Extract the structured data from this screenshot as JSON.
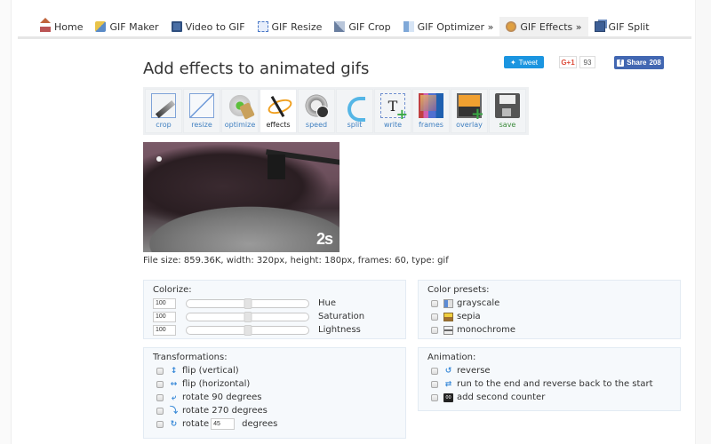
{
  "nav": {
    "items": [
      {
        "label": "Home",
        "icon": "home-icon",
        "active": false
      },
      {
        "label": "GIF Maker",
        "icon": "gif-maker-icon",
        "active": false
      },
      {
        "label": "Video to GIF",
        "icon": "film-icon",
        "active": false
      },
      {
        "label": "GIF Resize",
        "icon": "resize-icon",
        "active": false
      },
      {
        "label": "GIF Crop",
        "icon": "crop-icon",
        "active": false
      },
      {
        "label": "GIF Optimizer »",
        "icon": "optimizer-icon",
        "active": false
      },
      {
        "label": "GIF Effects »",
        "icon": "effects-palette-icon",
        "active": true
      },
      {
        "label": "GIF Split",
        "icon": "split-icon",
        "active": false
      }
    ]
  },
  "page": {
    "title": "Add effects to animated gifs"
  },
  "social": {
    "tweet_label": "Tweet",
    "gplus_label": "G+1",
    "gplus_count": "93",
    "fb_label": "Share",
    "fb_count": "208"
  },
  "tools": [
    {
      "label": "crop",
      "icon": "crop-tool-icon",
      "active": false
    },
    {
      "label": "resize",
      "icon": "resize-tool-icon",
      "active": false
    },
    {
      "label": "optimize",
      "icon": "optimize-tool-icon",
      "active": false
    },
    {
      "label": "effects",
      "icon": "magic-wand-icon",
      "active": true
    },
    {
      "label": "speed",
      "icon": "stopwatch-icon",
      "active": false
    },
    {
      "label": "split",
      "icon": "split-tool-icon",
      "active": false
    },
    {
      "label": "write",
      "icon": "text-add-icon",
      "active": false
    },
    {
      "label": "frames",
      "icon": "frames-icon",
      "active": false
    },
    {
      "label": "overlay",
      "icon": "overlay-add-icon",
      "active": false
    },
    {
      "label": "save",
      "icon": "floppy-disk-icon",
      "active": false
    }
  ],
  "preview": {
    "badge": "2s",
    "file_info": "File size: 859.36K, width: 320px, height: 180px, frames: 60, type: gif"
  },
  "colorize": {
    "title": "Colorize:",
    "rows": [
      {
        "value": "100",
        "label": "Hue",
        "slider_percent": 50
      },
      {
        "value": "100",
        "label": "Saturation",
        "slider_percent": 50
      },
      {
        "value": "100",
        "label": "Lightness",
        "slider_percent": 50
      }
    ]
  },
  "presets": {
    "title": "Color presets:",
    "items": [
      {
        "label": "grayscale",
        "icon": "grayscale-icon",
        "checked": false
      },
      {
        "label": "sepia",
        "icon": "sepia-icon",
        "checked": false
      },
      {
        "label": "monochrome",
        "icon": "monochrome-icon",
        "checked": false
      }
    ]
  },
  "transformations": {
    "title": "Transformations:",
    "items": [
      {
        "label": "flip (vertical)",
        "icon": "flip-vertical-icon",
        "checked": false
      },
      {
        "label": "flip (horizontal)",
        "icon": "flip-horizontal-icon",
        "checked": false
      },
      {
        "label": "rotate 90 degrees",
        "icon": "rotate-90-icon",
        "checked": false
      },
      {
        "label": "rotate 270 degrees",
        "icon": "rotate-270-icon",
        "checked": false
      }
    ],
    "rotate_custom": {
      "prefix": "rotate",
      "value": "45",
      "suffix": "degrees",
      "checked": false
    }
  },
  "animation": {
    "title": "Animation:",
    "items": [
      {
        "label": "reverse",
        "icon": "reverse-icon",
        "checked": false
      },
      {
        "label": "run to the end and reverse back to the start",
        "icon": "ping-pong-icon",
        "checked": false
      },
      {
        "label": "add second counter",
        "icon": "counter-icon",
        "checked": false
      }
    ]
  }
}
